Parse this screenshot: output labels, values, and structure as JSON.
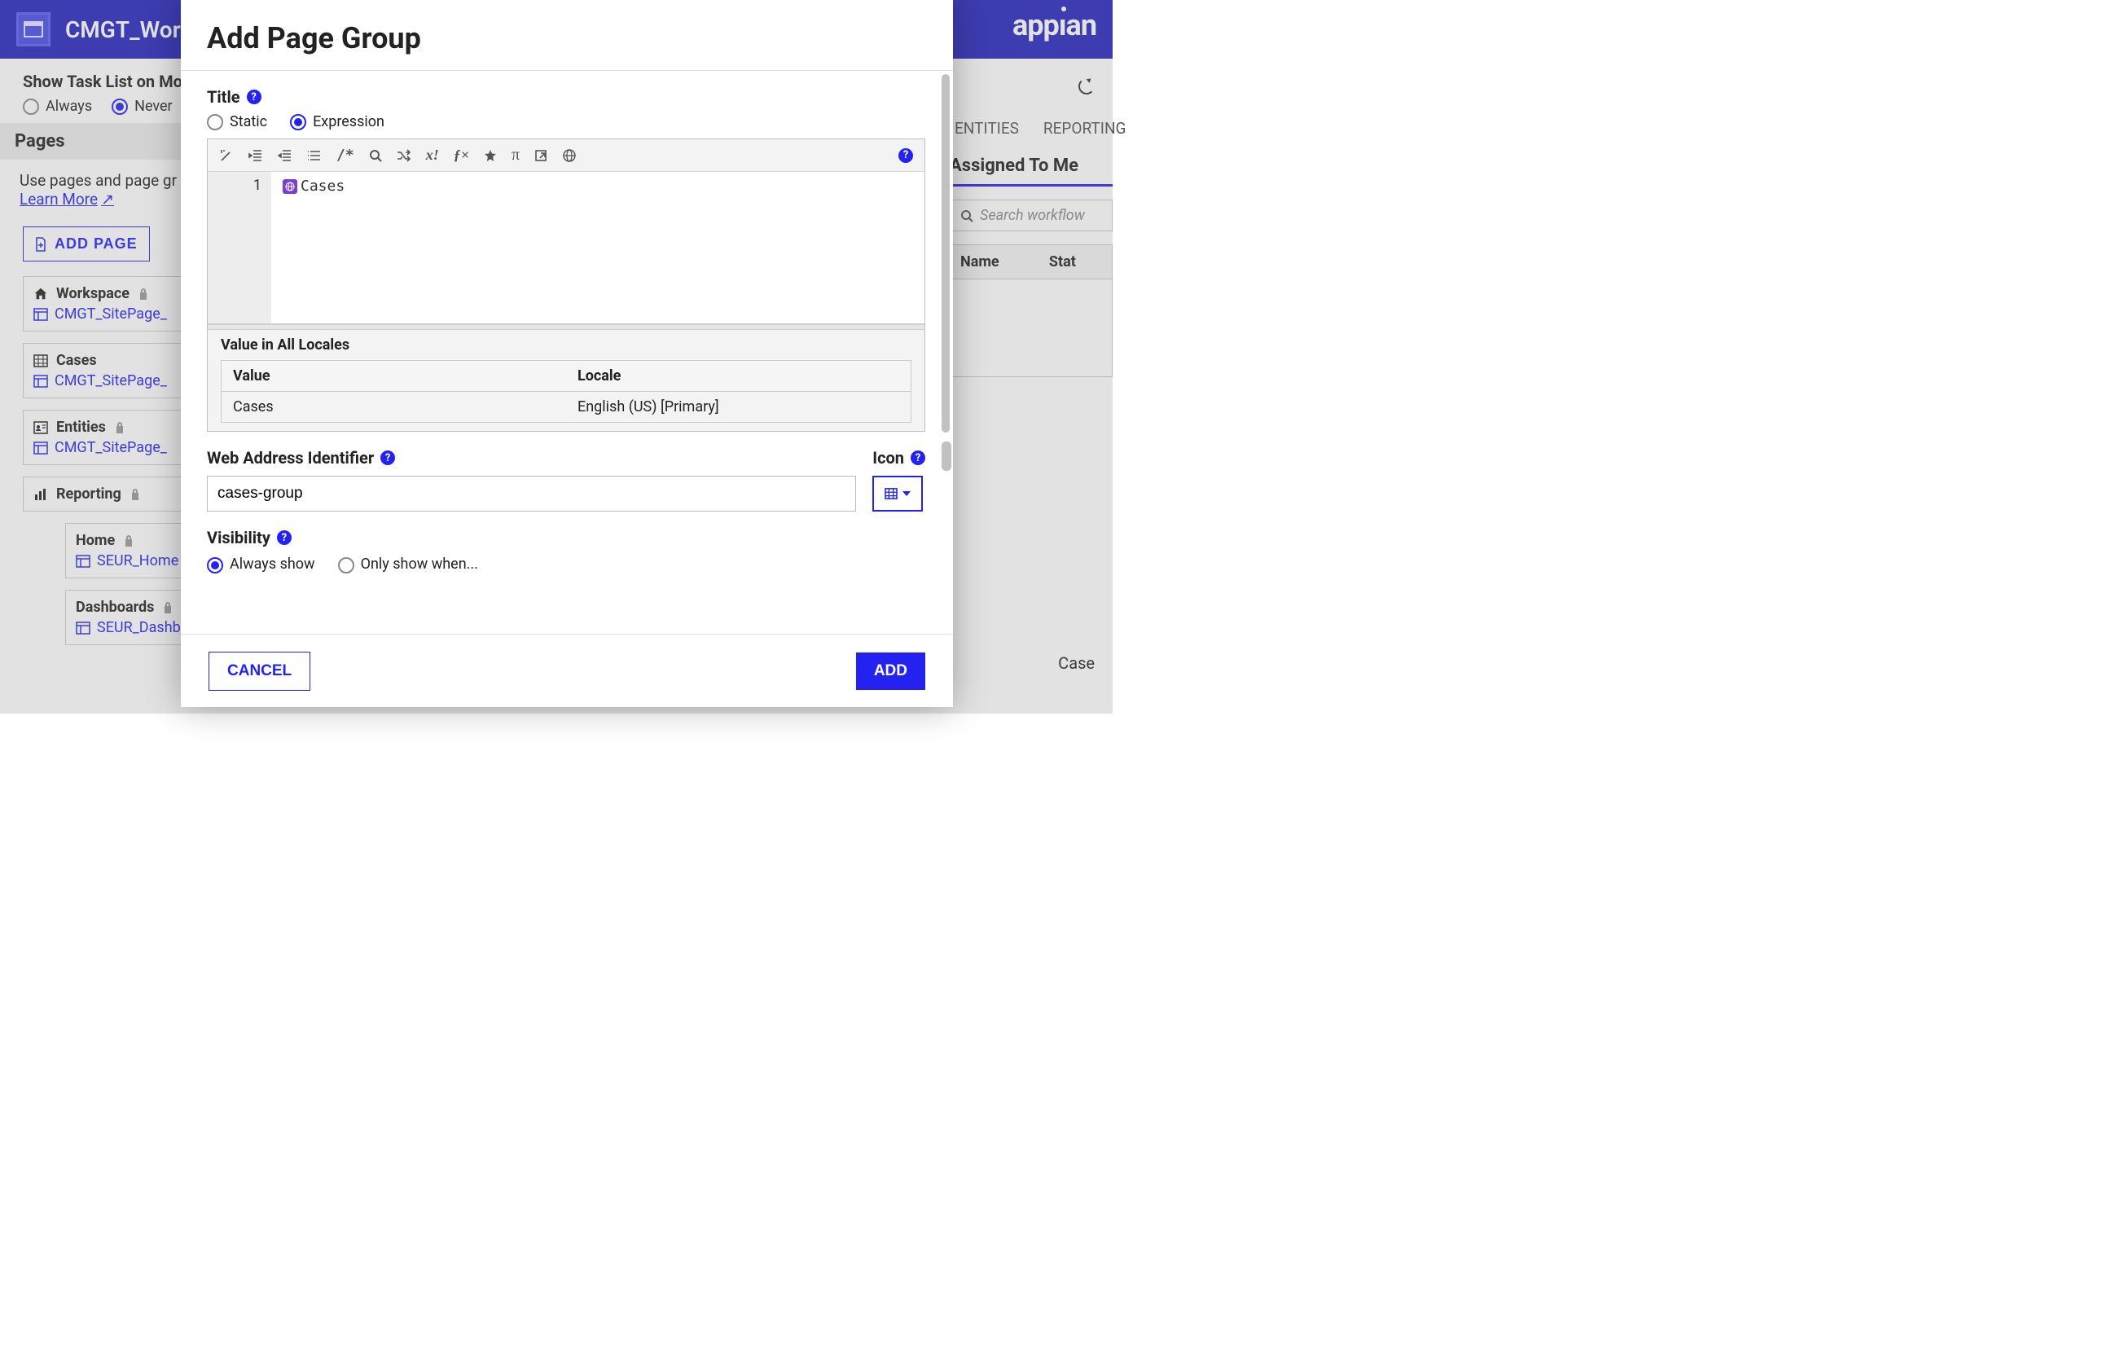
{
  "header": {
    "site_title": "CMGT_Wor",
    "brand": "appian"
  },
  "left": {
    "show_task_label": "Show Task List on Mo",
    "always": "Always",
    "never": "Never",
    "pages_heading": "Pages",
    "pages_desc": "Use pages and page gr",
    "learn_more": "Learn More",
    "add_page": "ADD PAGE",
    "nodes": [
      {
        "title": "Workspace",
        "locked": true,
        "child": "CMGT_SitePage_"
      },
      {
        "title": "Cases",
        "locked": false,
        "child": "CMGT_SitePage_"
      },
      {
        "title": "Entities",
        "locked": true,
        "child": "CMGT_SitePage_"
      },
      {
        "title": "Reporting",
        "locked": true,
        "child": ""
      }
    ],
    "child_nodes": [
      {
        "title": "Home",
        "locked": true,
        "child": "SEUR_Home"
      },
      {
        "title": "Dashboards",
        "locked": true,
        "child": "SEUR_DashboardsTab"
      }
    ]
  },
  "right": {
    "tabs": [
      "ENTITIES",
      "REPORTING"
    ],
    "assigned_header": "Assigned To Me",
    "search_placeholder": "Search workflow",
    "table": {
      "name": "Name",
      "status": "Stat"
    },
    "footer_link": "Case"
  },
  "dialog": {
    "title": "Add Page Group",
    "title_label": "Title",
    "static": "Static",
    "expression": "Expression",
    "editor_value": "Cases",
    "gutter_line": "1",
    "locales_label": "Value in All Locales",
    "locales_head_value": "Value",
    "locales_head_locale": "Locale",
    "locales_value": "Cases",
    "locales_locale": "English (US) [Primary]",
    "wai_label": "Web Address Identifier",
    "wai_value": "cases-group",
    "icon_label": "Icon",
    "visibility_label": "Visibility",
    "vis_always": "Always show",
    "vis_only": "Only show when...",
    "cancel": "CANCEL",
    "add": "ADD"
  }
}
